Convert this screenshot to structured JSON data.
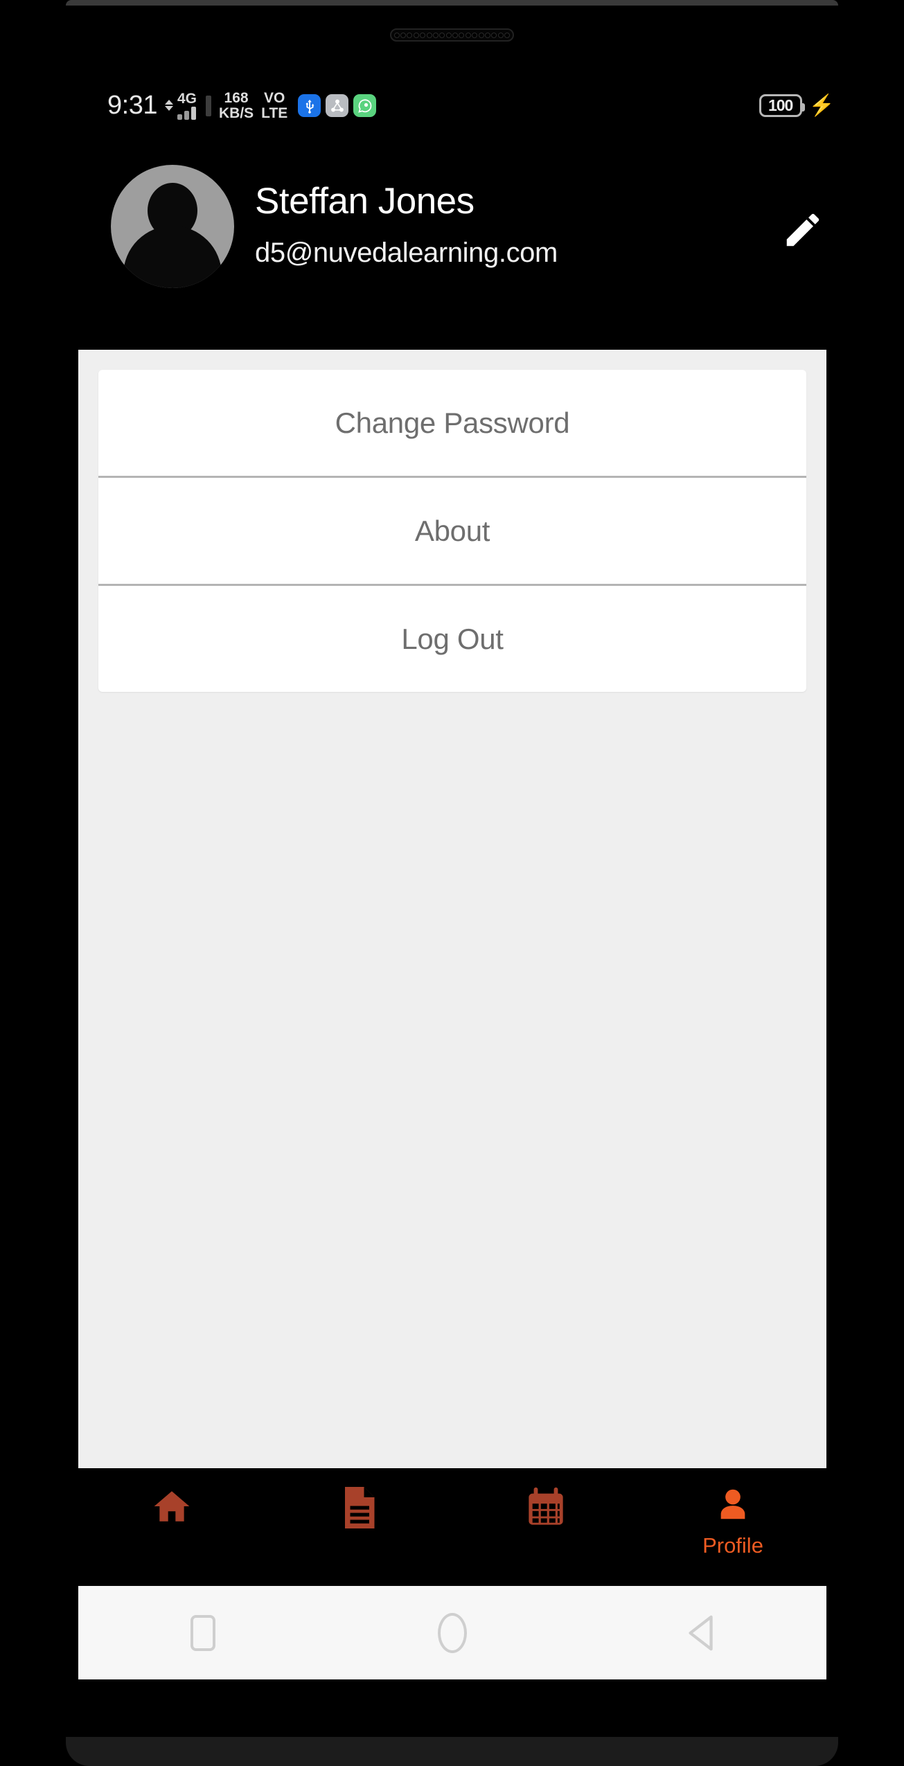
{
  "status_bar": {
    "clock": "9:31",
    "network_type": "4G",
    "data_rate_value": "168",
    "data_rate_unit": "KB/S",
    "volte_line1": "VO",
    "volte_line2": "LTE",
    "battery_level": "100",
    "charging_icon": "lightning-bolt-icon",
    "app_icons": [
      {
        "name": "usb-icon",
        "color": "#1b73e8"
      },
      {
        "name": "share-network-icon",
        "color": "#b9bcc1"
      },
      {
        "name": "whatsapp-icon",
        "color": "#5ad37f"
      }
    ],
    "signal_icon": "signal-bars-icon",
    "data_transfer_icon": "up-down-arrows-icon"
  },
  "profile": {
    "name": "Steffan Jones",
    "email": "d5@nuvedalearning.com",
    "avatar_icon": "default-user-avatar-icon",
    "edit_icon": "pencil-edit-icon"
  },
  "menu": {
    "items": [
      {
        "label": "Change Password"
      },
      {
        "label": "About"
      },
      {
        "label": "Log Out"
      }
    ]
  },
  "bottom_nav": {
    "active_color": "#ee5b22",
    "inactive_color": "#a8412a",
    "items": [
      {
        "label": "",
        "icon": "home-icon",
        "active": false
      },
      {
        "label": "",
        "icon": "document-icon",
        "active": false
      },
      {
        "label": "",
        "icon": "calendar-icon",
        "active": false
      },
      {
        "label": "Profile",
        "icon": "person-icon",
        "active": true
      }
    ]
  },
  "system_nav": {
    "recents_icon": "square-recents-icon",
    "home_icon": "circle-home-icon",
    "back_icon": "triangle-back-icon"
  }
}
